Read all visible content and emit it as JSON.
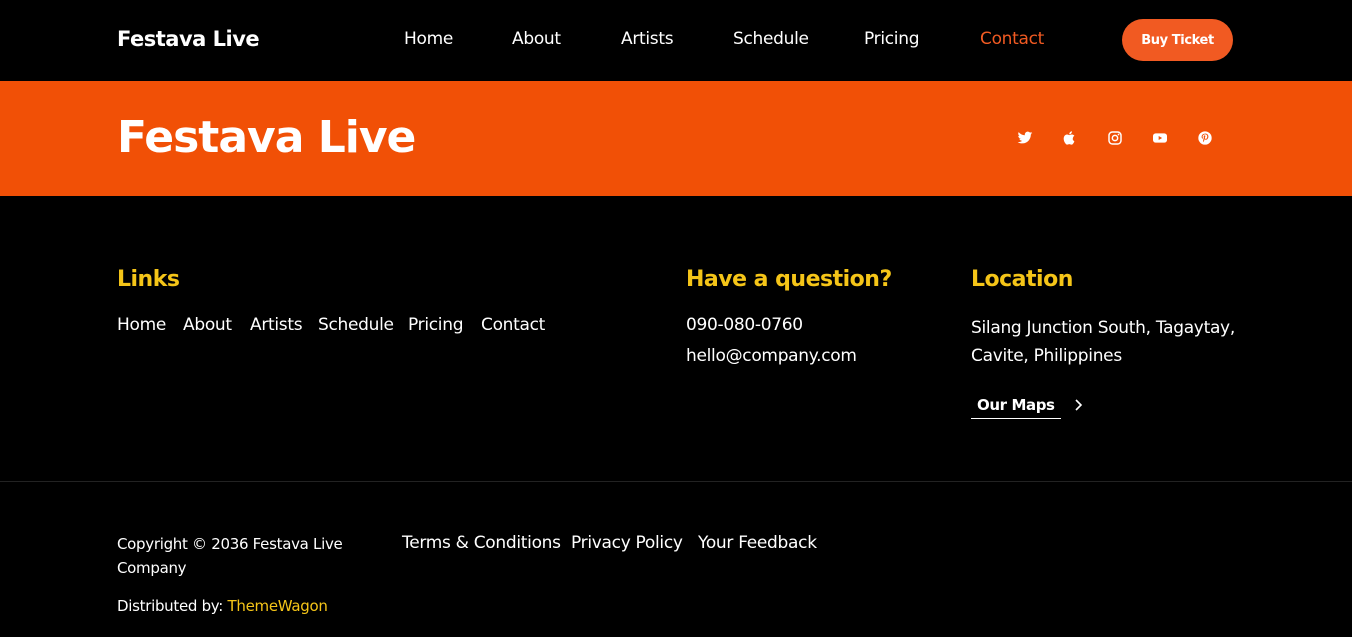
{
  "navbar": {
    "brand": "Festava Live",
    "items": [
      {
        "label": "Home",
        "active": false
      },
      {
        "label": "About",
        "active": false
      },
      {
        "label": "Artists",
        "active": false
      },
      {
        "label": "Schedule",
        "active": false
      },
      {
        "label": "Pricing",
        "active": false
      },
      {
        "label": "Contact",
        "active": true
      }
    ],
    "cta_label": "Buy Ticket"
  },
  "band": {
    "title": "Festava Live",
    "social_icons": [
      "twitter-icon",
      "apple-icon",
      "instagram-icon",
      "youtube-icon",
      "pinterest-icon"
    ]
  },
  "footer": {
    "links": {
      "heading": "Links",
      "items": [
        "Home",
        "About",
        "Artists",
        "Schedule",
        "Pricing",
        "Contact"
      ]
    },
    "question": {
      "heading": "Have a question?",
      "phone": "090-080-0760",
      "email": "hello@company.com"
    },
    "location": {
      "heading": "Location",
      "address": "Silang Junction South, Tagaytay, Cavite, Philippines",
      "maps_label": "Our Maps"
    }
  },
  "bottom": {
    "copyright": "Copyright © 2036 Festava Live Company",
    "distributed_prefix": "Distributed by:",
    "distributed_brand": "ThemeWagon",
    "legal_links": [
      "Terms & Conditions",
      "Privacy Policy",
      "Your Feedback"
    ]
  },
  "colors": {
    "accent": "#f15a22",
    "band": "#f15006",
    "heading": "#f5c518",
    "background": "#000000"
  }
}
